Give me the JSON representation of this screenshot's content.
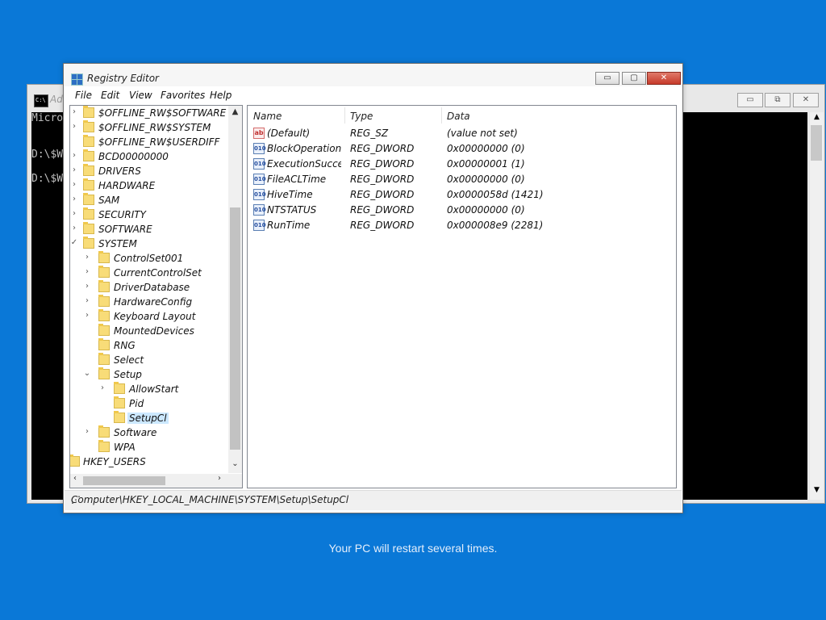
{
  "console": {
    "title": "Ad",
    "minimize_icon": "▭",
    "maximize_icon": "⧉",
    "close_icon": "✕",
    "lines": [
      "Micro",
      "",
      "",
      "D:\\$W",
      "",
      "D:\\$W"
    ]
  },
  "regedit": {
    "title": "Registry Editor",
    "buttons": {
      "minimize": "▭",
      "maximize": "▢",
      "close": "✕"
    },
    "menu": [
      "File",
      "Edit",
      "View",
      "Favorites",
      "Help"
    ],
    "tree": [
      {
        "label": "$OFFLINE_RW$SOFTWARE",
        "expander": "›"
      },
      {
        "label": "$OFFLINE_RW$SYSTEM",
        "expander": "›"
      },
      {
        "label": "$OFFLINE_RW$USERDIFF",
        "expander": ""
      },
      {
        "label": "BCD00000000",
        "expander": "›"
      },
      {
        "label": "DRIVERS",
        "expander": "›"
      },
      {
        "label": "HARDWARE",
        "expander": "›"
      },
      {
        "label": "SAM",
        "expander": "›"
      },
      {
        "label": "SECURITY",
        "expander": "›"
      },
      {
        "label": "SOFTWARE",
        "expander": "›"
      },
      {
        "label": "SYSTEM",
        "expander": "✓"
      },
      {
        "label": "ControlSet001",
        "expander": "›"
      },
      {
        "label": "CurrentControlSet",
        "expander": "›"
      },
      {
        "label": "DriverDatabase",
        "expander": "›"
      },
      {
        "label": "HardwareConfig",
        "expander": "›"
      },
      {
        "label": "Keyboard Layout",
        "expander": "›"
      },
      {
        "label": "MountedDevices",
        "expander": ""
      },
      {
        "label": "RNG",
        "expander": ""
      },
      {
        "label": "Select",
        "expander": ""
      },
      {
        "label": "Setup",
        "expander": "⌄"
      },
      {
        "label": "AllowStart",
        "expander": "›"
      },
      {
        "label": "Pid",
        "expander": ""
      },
      {
        "label": "SetupCl",
        "expander": ""
      },
      {
        "label": "Software",
        "expander": "›"
      },
      {
        "label": "WPA",
        "expander": ""
      },
      {
        "label": "HKEY_USERS",
        "expander": ""
      }
    ],
    "tree_scroll": {
      "up": "▲",
      "down": "⌄",
      "left": "‹",
      "right": "›"
    },
    "columns": [
      "Name",
      "Type",
      "Data"
    ],
    "values": [
      {
        "icon": "ab",
        "name": "(Default)",
        "type": "REG_SZ",
        "data": "(value not set)"
      },
      {
        "icon": "010",
        "name": "BlockOperations",
        "type": "REG_DWORD",
        "data": "0x00000000 (0)"
      },
      {
        "icon": "010",
        "name": "ExecutionSucces...",
        "type": "REG_DWORD",
        "data": "0x00000001 (1)"
      },
      {
        "icon": "010",
        "name": "FileACLTime",
        "type": "REG_DWORD",
        "data": "0x00000000 (0)"
      },
      {
        "icon": "010",
        "name": "HiveTime",
        "type": "REG_DWORD",
        "data": "0x0000058d (1421)"
      },
      {
        "icon": "010",
        "name": "NTSTATUS",
        "type": "REG_DWORD",
        "data": "0x00000000 (0)"
      },
      {
        "icon": "010",
        "name": "RunTime",
        "type": "REG_DWORD",
        "data": "0x000008e9 (2281)"
      }
    ],
    "status_path": "Computer\\HKEY_LOCAL_MACHINE\\SYSTEM\\Setup\\SetupCl"
  },
  "footer": {
    "message": "Your PC will restart several times."
  }
}
